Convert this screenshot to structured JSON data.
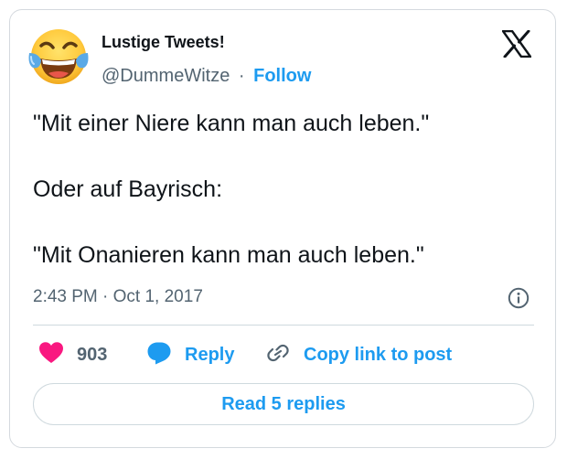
{
  "author": {
    "name": "Lustige Tweets!",
    "handle": "@DummeWitze",
    "separator": "·",
    "follow_label": "Follow",
    "avatar_icon": "face-with-tears-of-joy-emoji"
  },
  "platform_icon": "x-logo-icon",
  "tweet": {
    "lines": [
      "\"Mit einer Niere kann man auch leben.\"",
      "Oder auf Bayrisch:",
      "\"Mit Onanieren kann man auch leben.\""
    ]
  },
  "meta": {
    "time": "2:43 PM",
    "separator": "·",
    "date": "Oct 1, 2017"
  },
  "actions": {
    "like_count": "903",
    "reply_label": "Reply",
    "copy_label": "Copy link to post"
  },
  "read_replies_label": "Read 5 replies",
  "colors": {
    "accent": "#1d9bf0",
    "like": "#f91880",
    "text": "#0f1419",
    "muted": "#536471",
    "border": "#cfd9de"
  }
}
